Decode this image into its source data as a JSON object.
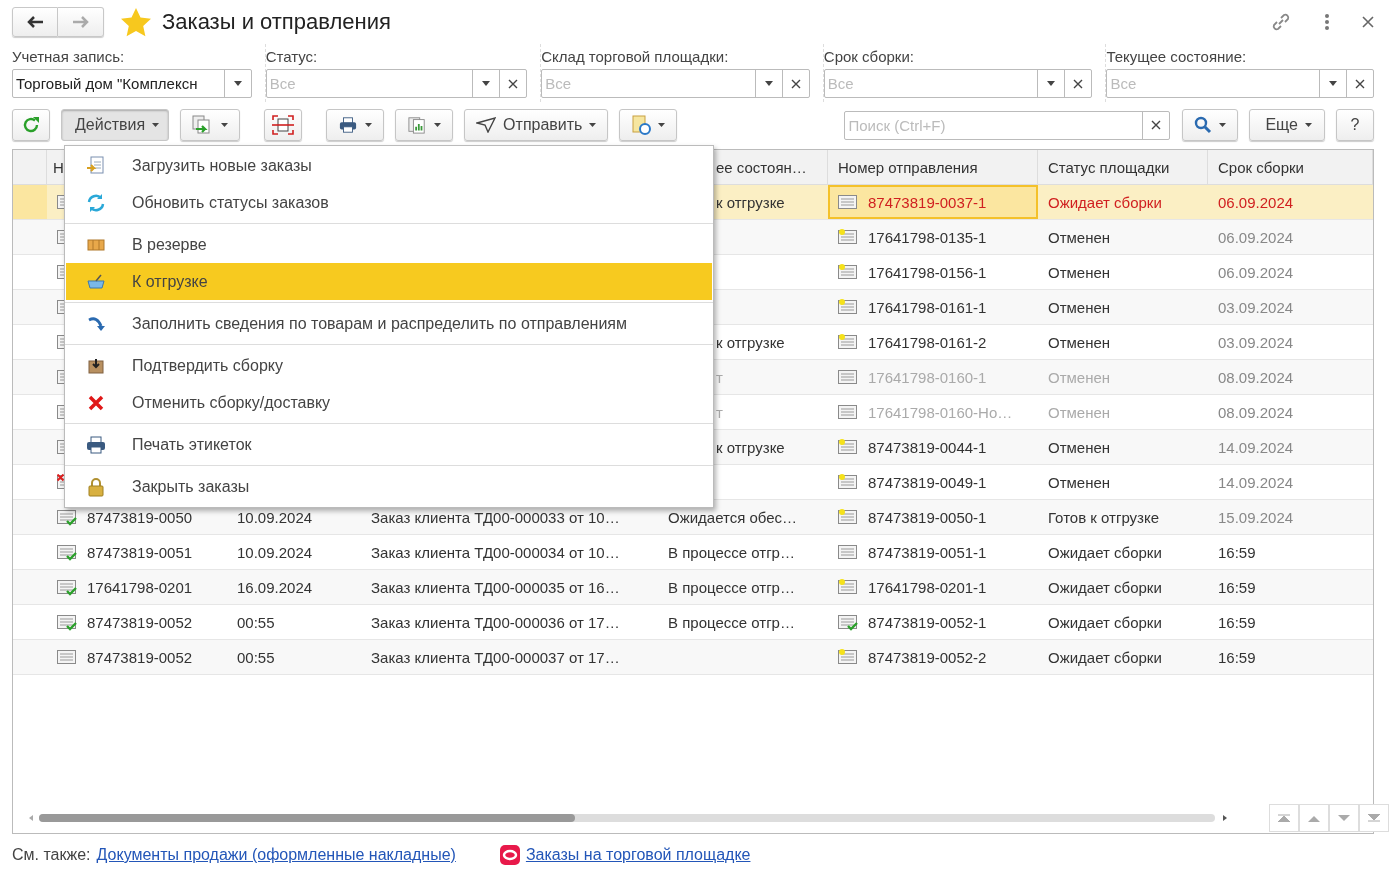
{
  "window": {
    "title": "Заказы и отправления"
  },
  "filters": [
    {
      "label": "Учетная запись:",
      "value": "Торговый дом \"Комплексн",
      "clearable": false
    },
    {
      "label": "Статус:",
      "placeholder": "Все",
      "clearable": true
    },
    {
      "label": "Склад торговой площадки:",
      "placeholder": "Все",
      "clearable": true
    },
    {
      "label": "Срок сборки:",
      "placeholder": "Все",
      "clearable": true
    },
    {
      "label": "Текущее состояние:",
      "placeholder": "Все",
      "clearable": true
    }
  ],
  "toolbar": {
    "actions_label": "Действия",
    "actions_pressed": true,
    "send_label": "Отправить",
    "search_placeholder": "Поиск (Ctrl+F)",
    "more_label": "Еще",
    "help_label": "?"
  },
  "table": {
    "columns": {
      "number": "Н",
      "state_tail": "ее состоян…",
      "shipment": "Номер отправления",
      "platform_status": "Статус площадки",
      "deadline": "Срок сборки"
    },
    "rows": [
      {
        "kind": "doc",
        "state_tail": "к отгрузке",
        "shipment": {
          "kind": "doc",
          "number": "87473819-0037-1"
        },
        "platform_status": "Ожидает сборки",
        "deadline": "06.09.2024",
        "deadline_dim": true,
        "selected": true,
        "alert": true,
        "disabled": false
      },
      {
        "kind": "doc",
        "shipment": {
          "kind": "doc-star",
          "number": "17641798-0135-1"
        },
        "platform_status": "Отменен",
        "deadline": "06.09.2024",
        "deadline_dim": true,
        "selected": false,
        "alert": false,
        "disabled": false
      },
      {
        "kind": "doc",
        "shipment": {
          "kind": "doc-star",
          "number": "17641798-0156-1"
        },
        "platform_status": "Отменен",
        "deadline": "06.09.2024",
        "deadline_dim": true,
        "selected": false,
        "alert": false,
        "disabled": false
      },
      {
        "kind": "doc",
        "shipment": {
          "kind": "doc-star",
          "number": "17641798-0161-1"
        },
        "platform_status": "Отменен",
        "deadline": "03.09.2024",
        "deadline_dim": true,
        "selected": false,
        "alert": false,
        "disabled": false
      },
      {
        "kind": "doc",
        "state_tail": "к отгрузке",
        "shipment": {
          "kind": "doc-star",
          "number": "17641798-0161-2"
        },
        "platform_status": "Отменен",
        "deadline": "03.09.2024",
        "deadline_dim": true,
        "selected": false,
        "alert": false,
        "disabled": false
      },
      {
        "kind": "doc",
        "state_tail": "т",
        "shipment": {
          "kind": "doc",
          "number": "17641798-0160-1"
        },
        "platform_status": "Отменен",
        "deadline": "08.09.2024",
        "deadline_dim": true,
        "selected": false,
        "alert": false,
        "disabled": true
      },
      {
        "kind": "doc",
        "state_tail": "т",
        "shipment": {
          "kind": "doc",
          "number": "17641798-0160-Но…"
        },
        "platform_status": "Отменен",
        "deadline": "08.09.2024",
        "deadline_dim": true,
        "selected": false,
        "alert": false,
        "disabled": true
      },
      {
        "kind": "doc",
        "state_tail": "к отгрузке",
        "shipment": {
          "kind": "doc-star",
          "number": "87473819-0044-1"
        },
        "platform_status": "Отменен",
        "deadline": "14.09.2024",
        "deadline_dim": true,
        "selected": false,
        "alert": false,
        "disabled": false
      },
      {
        "kind": "doc-cancel",
        "shipment": {
          "kind": "doc-star",
          "number": "87473819-0049-1"
        },
        "platform_status": "Отменен",
        "deadline": "14.09.2024",
        "deadline_dim": true,
        "selected": false,
        "alert": false,
        "disabled": false
      },
      {
        "kind": "doc-check",
        "number": "87473819-0050",
        "date": "10.09.2024",
        "order": "Заказ клиента ТД00-000033 от 10…",
        "state": "Ожидается обес…",
        "shipment": {
          "kind": "doc-star",
          "number": "87473819-0050-1"
        },
        "platform_status": "Готов к отгрузке",
        "deadline": "15.09.2024",
        "deadline_dim": true,
        "selected": false,
        "alert": false,
        "disabled": false
      },
      {
        "kind": "doc-check",
        "number": "87473819-0051",
        "date": "10.09.2024",
        "order": "Заказ клиента ТД00-000034 от 10…",
        "state": "В процессе отгр…",
        "shipment": {
          "kind": "doc",
          "number": "87473819-0051-1"
        },
        "platform_status": "Ожидает сборки",
        "deadline": "16:59",
        "deadline_dim": false,
        "selected": false,
        "alert": false,
        "disabled": false
      },
      {
        "kind": "doc-check",
        "number": "17641798-0201",
        "date": "16.09.2024",
        "order": "Заказ клиента ТД00-000035 от 16…",
        "state": "В процессе отгр…",
        "shipment": {
          "kind": "doc-star",
          "number": "17641798-0201-1"
        },
        "platform_status": "Ожидает сборки",
        "deadline": "16:59",
        "deadline_dim": false,
        "selected": false,
        "alert": false,
        "disabled": false
      },
      {
        "kind": "doc-check",
        "number": "87473819-0052",
        "date": "00:55",
        "order": "Заказ клиента ТД00-000036 от 17…",
        "state": "В процессе отгр…",
        "shipment": {
          "kind": "doc-check",
          "number": "87473819-0052-1"
        },
        "platform_status": "Ожидает сборки",
        "deadline": "16:59",
        "deadline_dim": false,
        "selected": false,
        "alert": false,
        "disabled": false
      },
      {
        "kind": "doc",
        "number": "87473819-0052",
        "date": "00:55",
        "order": "Заказ клиента ТД00-000037 от 17…",
        "shipment": {
          "kind": "doc-star",
          "number": "87473819-0052-2"
        },
        "platform_status": "Ожидает сборки",
        "deadline": "16:59",
        "deadline_dim": false,
        "selected": false,
        "alert": false,
        "disabled": false
      }
    ]
  },
  "menu": {
    "items": [
      {
        "kind": "import",
        "label": "Загрузить новые заказы",
        "selected": false,
        "separator_before": false
      },
      {
        "kind": "refresh",
        "label": "Обновить статусы заказов",
        "selected": false,
        "separator_before": false
      },
      {
        "kind": "reserve",
        "label": "В резерве",
        "selected": false,
        "separator_before": true
      },
      {
        "kind": "basket",
        "label": "К отгрузке",
        "selected": true,
        "separator_before": false
      },
      {
        "kind": "arrow",
        "label": "Заполнить сведения по товарам и распределить по отправлениям",
        "selected": false,
        "separator_before": true
      },
      {
        "kind": "box",
        "label": "Подтвердить сборку",
        "selected": false,
        "separator_before": true
      },
      {
        "kind": "cross",
        "label": "Отменить сборку/доставку",
        "selected": false,
        "separator_before": false
      },
      {
        "kind": "printer",
        "label": "Печать этикеток",
        "selected": false,
        "separator_before": true
      },
      {
        "kind": "lock",
        "label": "Закрыть заказы",
        "selected": false,
        "separator_before": true
      }
    ]
  },
  "see_also": {
    "label": "См. также:",
    "links": [
      {
        "label": "Документы продажи (оформленные накладные)",
        "icon": false
      },
      {
        "label": "Заказы на торговой площадке",
        "icon": true
      }
    ]
  }
}
